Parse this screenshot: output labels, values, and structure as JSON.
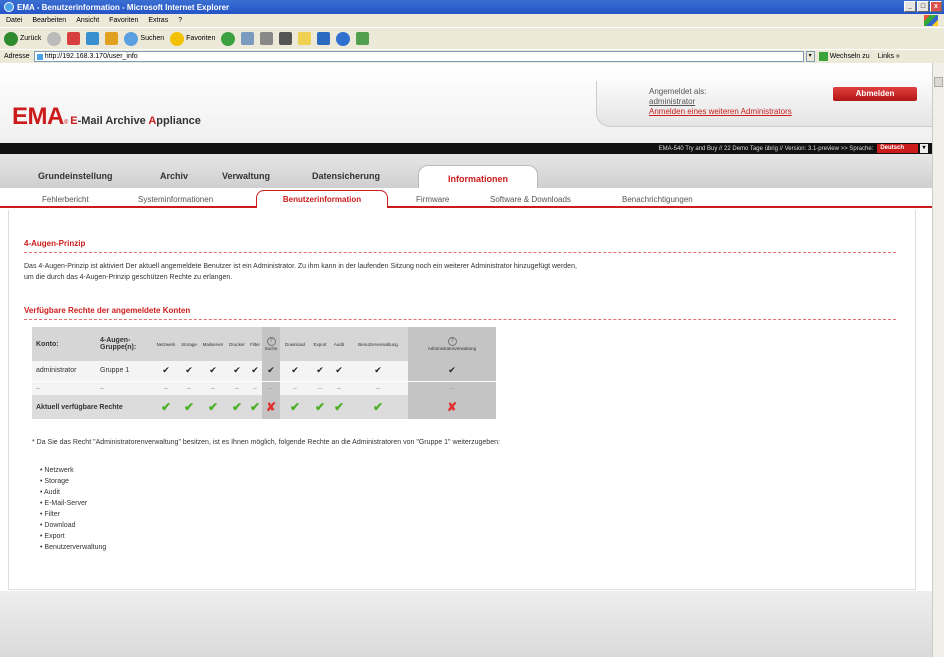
{
  "window": {
    "title": "EMA - Benutzerinformation - Microsoft Internet Explorer",
    "min": "_",
    "max": "□",
    "close": "x"
  },
  "menu": [
    "Datei",
    "Bearbeiten",
    "Ansicht",
    "Favoriten",
    "Extras",
    "?"
  ],
  "toolbar": {
    "back": "Zurück",
    "search": "Suchen",
    "favorites": "Favoriten"
  },
  "address": {
    "label": "Adresse",
    "url": "http://192.168.3.170/user_info",
    "go": "Wechseln zu",
    "links": "Links »"
  },
  "header": {
    "logo_main": "EMA",
    "logo_registered": "®",
    "logo_sub_e": "E",
    "logo_sub_mail": "-Mail ",
    "logo_sub_archive": "Archive ",
    "logo_sub_a": "A",
    "logo_sub_ppliance": "ppliance",
    "logged_in_label": "Angemeldet als:",
    "user": "administrator",
    "login_other": "Anmelden eines weiteren Administrators",
    "logout": "Abmelden"
  },
  "status_bar": {
    "text": "EMA-540 Try and Buy // 22 Demo Tage übrig // Version: 3.1-preview >> Sprache:",
    "language": "Deutsch"
  },
  "main_tabs": [
    "Grundeinstellung",
    "Archiv",
    "Verwaltung",
    "Datensicherung",
    "Informationen"
  ],
  "sub_tabs": [
    "Fehlerbericht",
    "Systeminformationen",
    "Benutzerinformation",
    "Firmware",
    "Software & Downloads",
    "Benachrichtigungen"
  ],
  "section1": {
    "title": "4-Augen-Prinzip",
    "text": "Das 4-Augen-Prinzip ist aktiviert Der aktuell angemeldete Benutzer ist ein Administrator. Zu ihm kann in der laufenden Sitzung noch ein weiterer Administrator hinzugefügt werden, um die durch das 4-Augen-Prinzip geschützen Rechte zu erlangen."
  },
  "section2": {
    "title": "Verfügbare Rechte der angemeldete Konten",
    "table": {
      "col_konto": "Konto:",
      "col_gruppe": "4-Augen-Gruppe(n):",
      "rights": [
        "Netzwerk",
        "Storage",
        "Mailserver",
        "Drucker",
        "Filter",
        "Suche",
        "Download",
        "Export",
        "Audit",
        "Benutzerverwaltung",
        "Administratorverwaltung"
      ],
      "info_icon": "?",
      "rows": [
        {
          "konto": "administrator",
          "gruppe": "Gruppe 1",
          "marks": [
            "✔",
            "✔",
            "✔",
            "✔",
            "✔",
            "✔",
            "✔",
            "✔",
            "✔",
            "✔",
            "✔"
          ]
        },
        {
          "konto": "–",
          "gruppe": "–",
          "marks": [
            "–",
            "–",
            "–",
            "–",
            "–",
            "–",
            "–",
            "–",
            "–",
            "–",
            "–"
          ]
        }
      ],
      "total_label": "Aktuell verfügbare Rechte",
      "total_marks": [
        "✔",
        "✔",
        "✔",
        "✔",
        "✔",
        "✘",
        "✔",
        "✔",
        "✔",
        "✔",
        "✘"
      ]
    }
  },
  "note": "* Da Sie das Recht \"Administratorenverwaltung\" besitzen, ist es Ihnen möglich, folgende Rechte an die Administratoren von \"Gruppe 1\" weiterzugeben:",
  "permissions": [
    "Netzwerk",
    "Storage",
    "Audit",
    "E-Mail-Server",
    "Filter",
    "Download",
    "Export",
    "Benutzerverwaltung"
  ]
}
